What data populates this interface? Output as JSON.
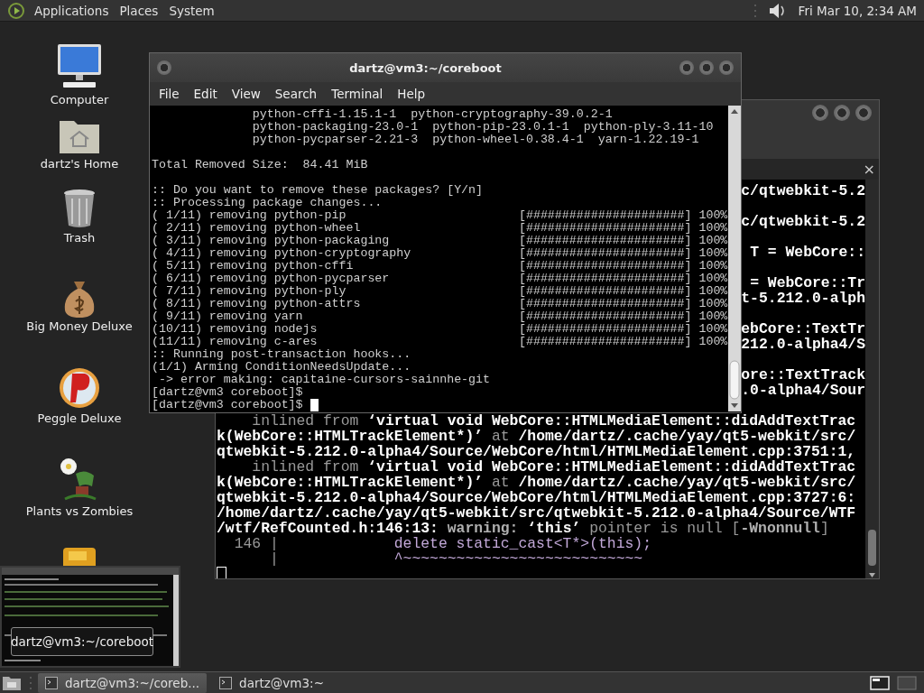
{
  "top_panel": {
    "menus": [
      "Applications",
      "Places",
      "System"
    ],
    "clock": "Fri Mar 10,  2:34 AM"
  },
  "desktop_icons": [
    {
      "kind": "computer",
      "label": "Computer"
    },
    {
      "kind": "home",
      "label": "dartz's Home"
    },
    {
      "kind": "trash",
      "label": "Trash"
    },
    {
      "kind": "money",
      "label": "Big Money Deluxe"
    },
    {
      "kind": "ball",
      "label": "Peggle Deluxe"
    },
    {
      "kind": "plant",
      "label": "Plants vs Zombies"
    },
    {
      "kind": "game"
    }
  ],
  "back_terminal": {
    "focused": false,
    "tab_close": "×",
    "rows": [
      {
        "kind": "clipped",
        "segments": [
          {
            "text": "c/qtwebkit-5.2",
            "kind": "bold"
          }
        ]
      },
      {
        "kind": "blank"
      },
      {
        "kind": "clipped",
        "segments": [
          {
            "text": "c/qtwebkit-5.2",
            "kind": "bold"
          }
        ]
      },
      {
        "kind": "blank"
      },
      {
        "kind": "clipped",
        "segments": [
          {
            "text": "T = WebCore::",
            "kind": "bold"
          }
        ]
      },
      {
        "kind": "blank"
      },
      {
        "kind": "clipped",
        "segments": [
          {
            "text": "= WebCore::Tr",
            "kind": "bold"
          }
        ]
      },
      {
        "kind": "clipped",
        "segments": [
          {
            "text": "t-5.212.0-alph",
            "kind": "bold"
          }
        ]
      },
      {
        "kind": "blank"
      },
      {
        "kind": "clipped",
        "segments": [
          {
            "text": "ebCore::TextTr",
            "kind": "bold"
          }
        ]
      },
      {
        "kind": "clipped",
        "segments": [
          {
            "text": "212.0-alpha4/S",
            "kind": "bold"
          }
        ]
      },
      {
        "kind": "blank"
      },
      {
        "kind": "clipped",
        "segments": [
          {
            "text": "ore::TextTrack",
            "kind": "bold"
          }
        ]
      },
      {
        "kind": "clipped",
        "segments": [
          {
            "text": ".0-alpha4/Sour",
            "kind": "bold"
          }
        ]
      },
      {
        "kind": "blank"
      },
      {
        "kind": "line",
        "segments": [
          {
            "text": "    inlined from ",
            "kind": "dim"
          },
          {
            "text": "‘virtual void WebCore::HTMLMediaElement::didAddTextTrac",
            "kind": "bold"
          }
        ]
      },
      {
        "kind": "line",
        "segments": [
          {
            "text": "k(WebCore::HTMLTrackElement*)’",
            "kind": "bold"
          },
          {
            "text": " at ",
            "kind": "dim"
          },
          {
            "text": "/home/dartz/.cache/yay/qt5-webkit/src/",
            "kind": "bold"
          }
        ]
      },
      {
        "kind": "line",
        "segments": [
          {
            "text": "qtwebkit-5.212.0-alpha4/Source/WebCore/html/HTMLMediaElement.cpp:3751:1,",
            "kind": "bold"
          }
        ]
      },
      {
        "kind": "line",
        "segments": [
          {
            "text": "    inlined from ",
            "kind": "dim"
          },
          {
            "text": "‘virtual void WebCore::HTMLMediaElement::didAddTextTrac",
            "kind": "bold"
          }
        ]
      },
      {
        "kind": "line",
        "segments": [
          {
            "text": "k(WebCore::HTMLTrackElement*)’",
            "kind": "bold"
          },
          {
            "text": " at ",
            "kind": "dim"
          },
          {
            "text": "/home/dartz/.cache/yay/qt5-webkit/src/",
            "kind": "bold"
          }
        ]
      },
      {
        "kind": "line",
        "segments": [
          {
            "text": "qtwebkit-5.212.0-alpha4/Source/WebCore/html/HTMLMediaElement.cpp:3727:6:",
            "kind": "bold"
          }
        ]
      },
      {
        "kind": "line",
        "segments": [
          {
            "text": "/home/dartz/.cache/yay/qt5-webkit/src/qtwebkit-5.212.0-alpha4/Source/WTF",
            "kind": "bold"
          }
        ]
      },
      {
        "kind": "line",
        "segments": [
          {
            "text": "/wtf/RefCounted.h:146:13: ",
            "kind": "bold"
          },
          {
            "text": "warning: ",
            "kind": "warn"
          },
          {
            "text": "‘this’",
            "kind": "bold"
          },
          {
            "text": " pointer is null [",
            "kind": "dim"
          },
          {
            "text": "-Wnonnull",
            "kind": "warn"
          },
          {
            "text": "]",
            "kind": "dim"
          }
        ]
      },
      {
        "kind": "line",
        "segments": [
          {
            "text": "  146 |             ",
            "kind": "dim"
          },
          {
            "text": "delete static_cast<T*>(this);",
            "kind": "accent"
          }
        ]
      },
      {
        "kind": "line",
        "segments": [
          {
            "text": "      |             ",
            "kind": "dim"
          },
          {
            "text": "^~~~~~~~~~~~~~~~~~~~~~~~~~~~",
            "kind": "accent"
          }
        ]
      },
      {
        "kind": "line",
        "cursor": true
      }
    ]
  },
  "front_terminal": {
    "title": "dartz@vm3:~/coreboot",
    "focused": true,
    "menus": [
      "File",
      "Edit",
      "View",
      "Search",
      "Terminal",
      "Help"
    ],
    "rows": [
      {
        "kind": "line",
        "text": "              python-cffi-1.15.1-1  python-cryptography-39.0.2-1"
      },
      {
        "kind": "line",
        "text": "              python-packaging-23.0-1  python-pip-23.0.1-1  python-ply-3.11-10"
      },
      {
        "kind": "line",
        "text": "              python-pycparser-2.21-3  python-wheel-0.38.4-1  yarn-1.22.19-1"
      },
      {
        "kind": "blank"
      },
      {
        "kind": "line",
        "text": "Total Removed Size:  84.41 MiB"
      },
      {
        "kind": "blank"
      },
      {
        "kind": "line",
        "text": ":: Do you want to remove these packages? [Y/n]"
      },
      {
        "kind": "line",
        "text": ":: Processing package changes..."
      },
      {
        "kind": "progress",
        "text": "( 1/11) removing python-pip",
        "bar": "[######################]",
        "percent": "100%"
      },
      {
        "kind": "progress",
        "text": "( 2/11) removing python-wheel",
        "bar": "[######################]",
        "percent": "100%"
      },
      {
        "kind": "progress",
        "text": "( 3/11) removing python-packaging",
        "bar": "[######################]",
        "percent": "100%"
      },
      {
        "kind": "progress",
        "text": "( 4/11) removing python-cryptography",
        "bar": "[######################]",
        "percent": "100%"
      },
      {
        "kind": "progress",
        "text": "( 5/11) removing python-cffi",
        "bar": "[######################]",
        "percent": "100%"
      },
      {
        "kind": "progress",
        "text": "( 6/11) removing python-pycparser",
        "bar": "[######################]",
        "percent": "100%"
      },
      {
        "kind": "progress",
        "text": "( 7/11) removing python-ply",
        "bar": "[######################]",
        "percent": "100%"
      },
      {
        "kind": "progress",
        "text": "( 8/11) removing python-attrs",
        "bar": "[######################]",
        "percent": "100%"
      },
      {
        "kind": "progress",
        "text": "( 9/11) removing yarn",
        "bar": "[######################]",
        "percent": "100%"
      },
      {
        "kind": "progress",
        "text": "(10/11) removing nodejs",
        "bar": "[######################]",
        "percent": "100%"
      },
      {
        "kind": "progress",
        "text": "(11/11) removing c-ares",
        "bar": "[######################]",
        "percent": "100%"
      },
      {
        "kind": "line",
        "text": ":: Running post-transaction hooks..."
      },
      {
        "kind": "line",
        "text": "(1/1) Arming ConditionNeedsUpdate..."
      },
      {
        "kind": "line",
        "text": " -> error making: capitaine-cursors-sainnhe-git"
      },
      {
        "kind": "line",
        "text": "[dartz@vm3 coreboot]$"
      },
      {
        "kind": "line",
        "text": "[dartz@vm3 coreboot]$ ",
        "cursor": true
      }
    ]
  },
  "tooltip": "dartz@vm3:~/coreboot",
  "taskbar": {
    "items": [
      {
        "label": "dartz@vm3:~/coreb...",
        "selected": true
      },
      {
        "label": "dartz@vm3:~",
        "selected": false
      }
    ]
  }
}
